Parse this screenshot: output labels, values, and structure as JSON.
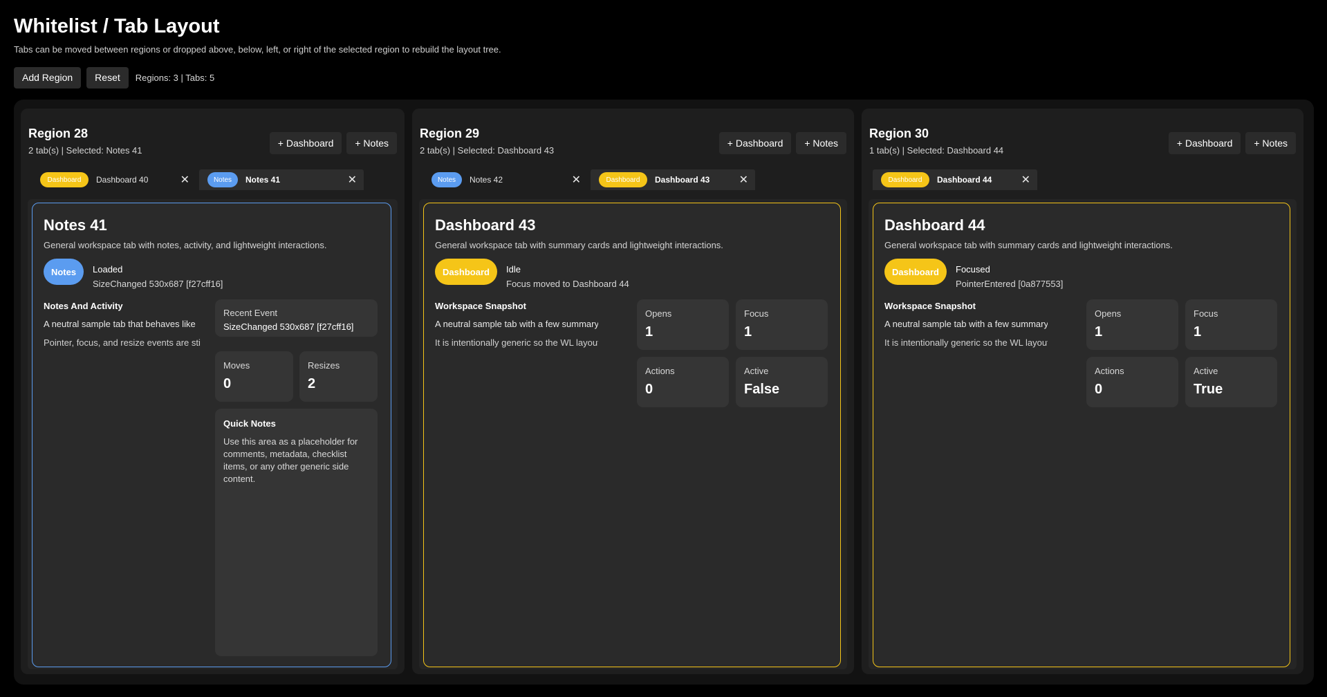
{
  "app": {
    "title": "Whitelist / Tab Layout",
    "subtitle": "Tabs can be moved between regions or dropped above, below, left, or right of the selected region to rebuild the layout tree."
  },
  "toolbar": {
    "add_region_label": "Add Region",
    "reset_label": "Reset",
    "status": "Regions: 3 | Tabs: 5"
  },
  "colors": {
    "dashboard_badge": "#f5c518",
    "notes_badge": "#5b9cf0",
    "background": "#000000"
  },
  "regions": [
    {
      "title": "Region 28",
      "info": "2 tab(s) | Selected: Notes 41",
      "add_dashboard_label": "+ Dashboard",
      "add_notes_label": "+ Notes",
      "tabs": [
        {
          "badge": "Dashboard",
          "label": "Dashboard 40",
          "close": "✕",
          "active": false
        },
        {
          "badge": "Notes",
          "label": "Notes 41",
          "close": "✕",
          "active": true
        }
      ],
      "content": {
        "title": "Notes 41",
        "description": "General workspace tab with notes, activity, and lightweight interactions.",
        "badge": "Notes",
        "state": "Loaded",
        "state_detail": "SizeChanged 530x687 [f27cff16]",
        "section_title": "Notes And Activity",
        "line1": "A neutral sample tab that behaves like",
        "line2": "Pointer, focus, and resize events are sti",
        "recent_event_label": "Recent Event",
        "recent_event_value": "SizeChanged 530x687 [f27cff16]",
        "moves_label": "Moves",
        "moves_value": "0",
        "resizes_label": "Resizes",
        "resizes_value": "2",
        "quick_notes_title": "Quick Notes",
        "quick_notes_text": "Use this area as a placeholder for comments, metadata, checklist items, or any other generic side content."
      }
    },
    {
      "title": "Region 29",
      "info": "2 tab(s) | Selected: Dashboard 43",
      "add_dashboard_label": "+ Dashboard",
      "add_notes_label": "+ Notes",
      "tabs": [
        {
          "badge": "Notes",
          "label": "Notes 42",
          "close": "✕",
          "active": false
        },
        {
          "badge": "Dashboard",
          "label": "Dashboard 43",
          "close": "✕",
          "active": true
        }
      ],
      "content": {
        "title": "Dashboard 43",
        "description": "General workspace tab with summary cards and lightweight interactions.",
        "badge": "Dashboard",
        "state": "Idle",
        "state_detail": "Focus moved to Dashboard 44",
        "section_title": "Workspace Snapshot",
        "line1": "A neutral sample tab with a few summary blo",
        "line2": "It is intentionally generic so the WL layout de",
        "opens_label": "Opens",
        "opens_value": "1",
        "focus_label": "Focus",
        "focus_value": "1",
        "actions_label": "Actions",
        "actions_value": "0",
        "active_label": "Active",
        "active_value": "False"
      }
    },
    {
      "title": "Region 30",
      "info": "1 tab(s) | Selected: Dashboard 44",
      "add_dashboard_label": "+ Dashboard",
      "add_notes_label": "+ Notes",
      "tabs": [
        {
          "badge": "Dashboard",
          "label": "Dashboard 44",
          "close": "✕",
          "active": true
        }
      ],
      "content": {
        "title": "Dashboard 44",
        "description": "General workspace tab with summary cards and lightweight interactions.",
        "badge": "Dashboard",
        "state": "Focused",
        "state_detail": "PointerEntered [0a877553]",
        "section_title": "Workspace Snapshot",
        "line1": "A neutral sample tab with a few summary blo",
        "line2": "It is intentionally generic so the WL layout de",
        "opens_label": "Opens",
        "opens_value": "1",
        "focus_label": "Focus",
        "focus_value": "1",
        "actions_label": "Actions",
        "actions_value": "0",
        "active_label": "Active",
        "active_value": "True"
      }
    }
  ]
}
